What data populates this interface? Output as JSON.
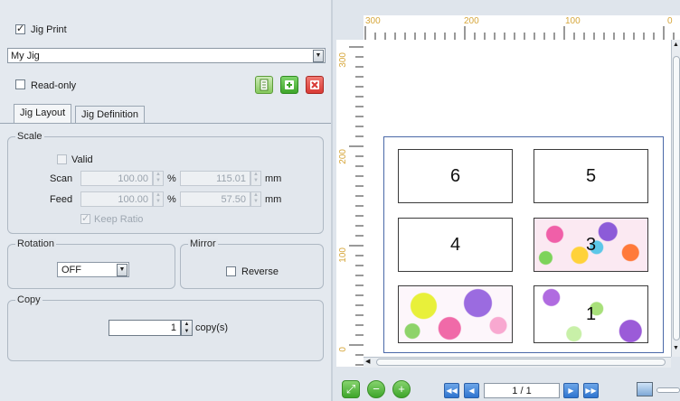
{
  "left": {
    "jig_print": {
      "label": "Jig Print",
      "checked": true
    },
    "jig_select": {
      "value": "My Jig"
    },
    "read_only": {
      "label": "Read-only",
      "checked": false
    },
    "tabs": [
      {
        "label": "Jig Layout",
        "active": true
      },
      {
        "label": "Jig Definition",
        "active": false
      }
    ],
    "scale": {
      "title": "Scale",
      "valid_label": "Valid",
      "scan_label": "Scan",
      "scan_value": "100.00",
      "scan_pct_unit": "%",
      "scan_mm_value": "115.01",
      "scan_mm_unit": "mm",
      "feed_label": "Feed",
      "feed_value": "100.00",
      "feed_pct_unit": "%",
      "feed_mm_value": "57.50",
      "feed_mm_unit": "mm",
      "keep_ratio_label": "Keep Ratio"
    },
    "rotation": {
      "title": "Rotation",
      "value": "OFF"
    },
    "mirror": {
      "title": "Mirror",
      "reverse_label": "Reverse"
    },
    "copy": {
      "title": "Copy",
      "value": "1",
      "unit": "copy(s)"
    }
  },
  "right": {
    "ruler_h_labels": [
      "300",
      "200",
      "100",
      "0"
    ],
    "ruler_v_labels": [
      "300",
      "200",
      "100",
      "0"
    ],
    "slots": [
      "6",
      "5",
      "4",
      "3",
      "",
      "1"
    ],
    "page_indicator": "1 / 1"
  },
  "colors": {
    "accent_green": "#3ea52a",
    "delete_red": "#d93a35",
    "nav_blue": "#2f74cf"
  }
}
